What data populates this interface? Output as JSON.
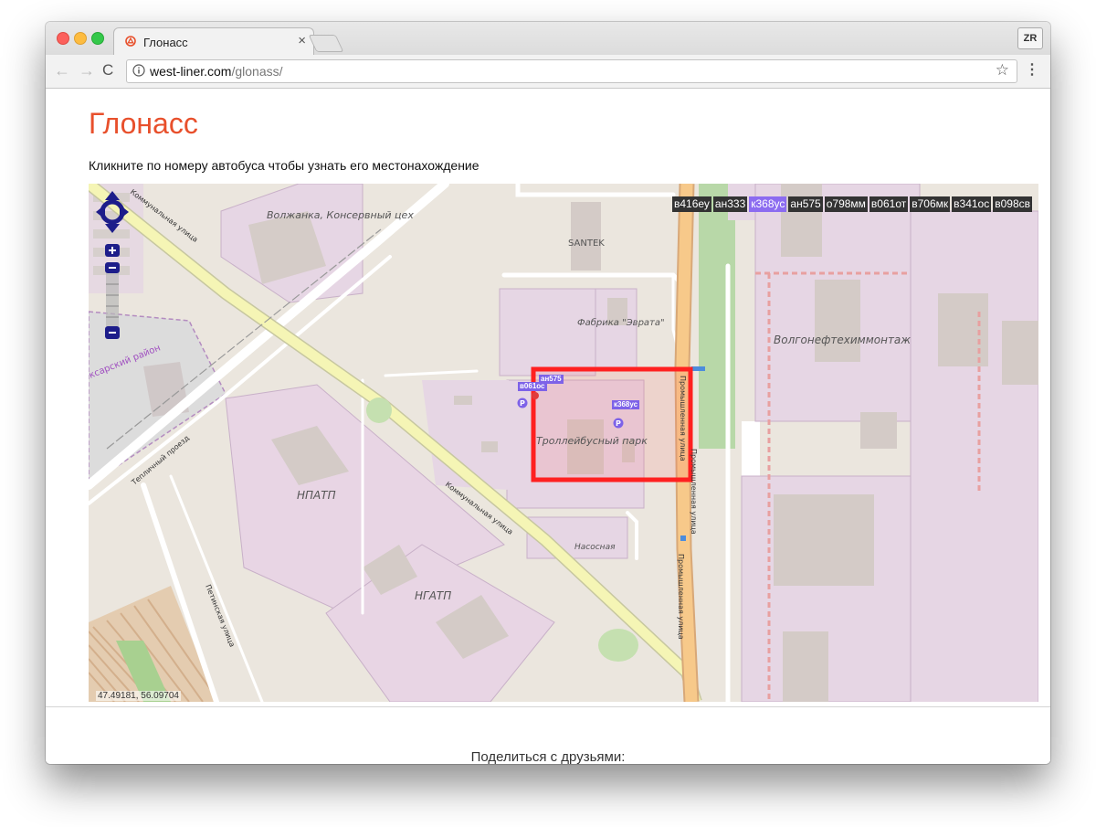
{
  "browser": {
    "tab_title": "Глонасс",
    "tab_close": "×",
    "url_host": "west-liner.com",
    "url_path": "/glonass/",
    "profile": "ZR",
    "back": "←",
    "forward": "→",
    "reload": "C",
    "star": "☆",
    "menu": "⋮"
  },
  "page": {
    "title": "Глонасс",
    "instruction": "Кликните по номеру автобуса чтобы узнать его местонахождение",
    "share": "Поделиться с друзьями:"
  },
  "map": {
    "coordinates": "47.49181, 56.09704",
    "buses": [
      "в416еу",
      "ан333",
      "к368ус",
      "ан575",
      "о798мм",
      "в061от",
      "в706мк",
      "в341ос",
      "в098св"
    ],
    "selected_bus": "к368ус",
    "marker_labels": [
      "ан575",
      "в061ос",
      "к368ус"
    ],
    "poi_labels": {
      "volzhanka": "Волжанка, Консервный цех",
      "santek": "SANTEK",
      "fabrika": "Фабрика \"Эврата\"",
      "volgoneft": "Волгонефтехиммонтаж",
      "trolley_park": "Троллейбусный парк",
      "npatp": "НПАТП",
      "ngatp": "НГАТП",
      "nasosnaya": "Насосная",
      "district": "ксарский район"
    },
    "street_labels": {
      "kommunalnaya_top": "Коммунальная улица",
      "kommunalnaya": "Коммунальная улица",
      "teplichny": "Тепличный проезд",
      "petinskaya": "Петинская улица",
      "promyshlennaya_1": "Промышленная улица",
      "promyshlennaya_2": "Промышленная улица",
      "promyshlennaya_3": "Промышленная улица"
    },
    "parking_symbol": "P",
    "colors": {
      "highlight": "#ff2020",
      "selected_bus": "#8c6cf0",
      "marker": "#7d62e8",
      "title": "#e8502c"
    }
  }
}
